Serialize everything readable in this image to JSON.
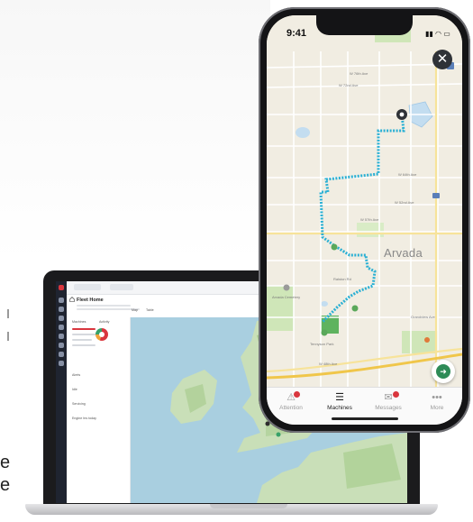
{
  "page": {
    "stray_text": [
      "e",
      "e"
    ]
  },
  "laptop_app": {
    "title": "Fleet Home",
    "side_tabs": [
      "Machines",
      "Activity"
    ],
    "side_rows": [
      "Alerts",
      "Idle",
      "Servicing",
      "Engine hrs today"
    ],
    "map_tabs": [
      "Map",
      "Table"
    ]
  },
  "phone": {
    "status_time": "9:41",
    "status_icons": "▮▮ ◠ ▭",
    "map_town_label": "Arvada",
    "map_street_labels": [
      "W 76th Ave",
      "W 72nd Ave",
      "W 64th Ave",
      "W 52nd Ave",
      "W 57th Ave",
      "Ralston Rd",
      "Grandview Ave",
      "W 48th Ave",
      "Tennyson Park",
      "Arvada Cemetery"
    ],
    "close_glyph": "✕",
    "nav_glyph": "➜",
    "tabs": [
      {
        "label": "Attention",
        "icon": "warning-icon",
        "glyph": "⚠",
        "badge": true,
        "active": false
      },
      {
        "label": "Machines",
        "icon": "machines-list-icon",
        "glyph": "☰",
        "badge": false,
        "active": true
      },
      {
        "label": "Messages",
        "icon": "messages-icon",
        "glyph": "✉",
        "badge": true,
        "active": false
      },
      {
        "label": "More",
        "icon": "more-icon",
        "glyph": "•••",
        "badge": false,
        "active": false
      }
    ]
  },
  "colors": {
    "route": "#2ab0d4",
    "active_tab": "#222222",
    "inactive_tab": "#9a9a9a",
    "badge": "#d9363e",
    "fab": "#2e8b57"
  }
}
